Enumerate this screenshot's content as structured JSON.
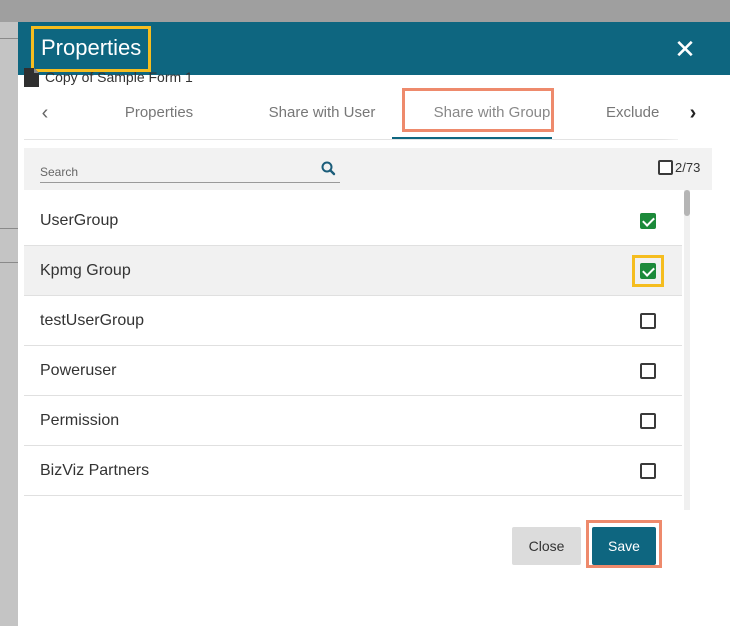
{
  "dialog": {
    "title": "Properties",
    "close_glyph": "✕"
  },
  "file": {
    "icon": "document-icon",
    "name": "Copy of Sample Form 1"
  },
  "tabs": [
    {
      "label": "Properties"
    },
    {
      "label": "Share with User"
    },
    {
      "label": "Share with Group",
      "active": true
    },
    {
      "label": "Exclude"
    }
  ],
  "tab_nav": {
    "prev": "‹",
    "next": "›"
  },
  "search": {
    "placeholder": "Search",
    "icon": "search-icon",
    "selected_count": "2/73"
  },
  "groups": [
    {
      "name": "UserGroup",
      "checked": true
    },
    {
      "name": "Kpmg Group",
      "checked": true
    },
    {
      "name": "testUserGroup",
      "checked": false
    },
    {
      "name": "Poweruser",
      "checked": false
    },
    {
      "name": "Permission",
      "checked": false
    },
    {
      "name": "BizViz Partners",
      "checked": false
    }
  ],
  "footer": {
    "close_label": "Close",
    "save_label": "Save"
  },
  "colors": {
    "header": "#0e6680",
    "checked": "#1c8a3a",
    "highlight_yellow": "#f5bd1f",
    "highlight_orange": "#ee8a6c"
  }
}
